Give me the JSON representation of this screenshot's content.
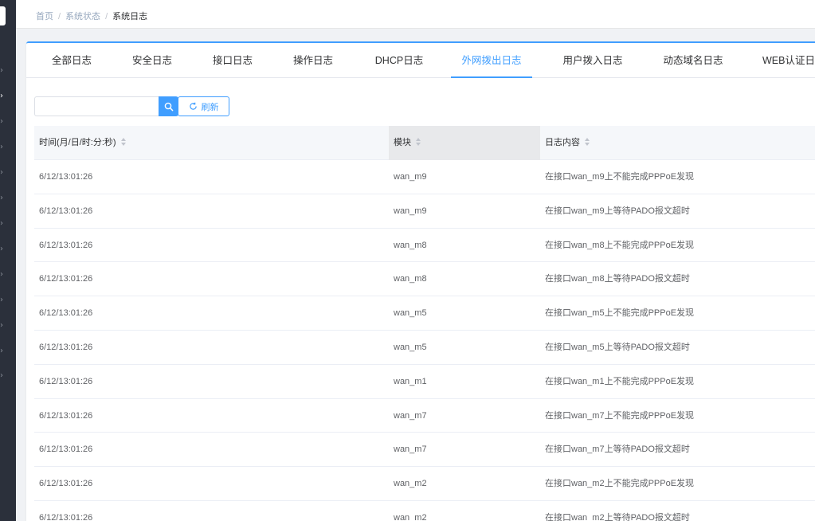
{
  "breadcrumb": {
    "items": [
      "首页",
      "系统状态"
    ],
    "separator": "/",
    "current": "系统日志"
  },
  "tabs": [
    {
      "label": "全部日志",
      "active": false
    },
    {
      "label": "安全日志",
      "active": false
    },
    {
      "label": "接口日志",
      "active": false
    },
    {
      "label": "操作日志",
      "active": false
    },
    {
      "label": "DHCP日志",
      "active": false
    },
    {
      "label": "外网拨出日志",
      "active": true
    },
    {
      "label": "用户拨入日志",
      "active": false
    },
    {
      "label": "动态域名日志",
      "active": false
    },
    {
      "label": "WEB认证日",
      "active": false
    }
  ],
  "toolbar": {
    "search_value": "",
    "search_placeholder": "",
    "refresh_label": "刷新"
  },
  "table": {
    "columns": [
      "时间(月/日/时:分:秒)",
      "模块",
      "日志内容"
    ],
    "sorted_column": 1,
    "rows": [
      [
        "6/12/13:01:26",
        "wan_m9",
        "在接口wan_m9上不能完成PPPoE发现"
      ],
      [
        "6/12/13:01:26",
        "wan_m9",
        "在接口wan_m9上等待PADO报文超时"
      ],
      [
        "6/12/13:01:26",
        "wan_m8",
        "在接口wan_m8上不能完成PPPoE发现"
      ],
      [
        "6/12/13:01:26",
        "wan_m8",
        "在接口wan_m8上等待PADO报文超时"
      ],
      [
        "6/12/13:01:26",
        "wan_m5",
        "在接口wan_m5上不能完成PPPoE发现"
      ],
      [
        "6/12/13:01:26",
        "wan_m5",
        "在接口wan_m5上等待PADO报文超时"
      ],
      [
        "6/12/13:01:26",
        "wan_m1",
        "在接口wan_m1上不能完成PPPoE发现"
      ],
      [
        "6/12/13:01:26",
        "wan_m7",
        "在接口wan_m7上不能完成PPPoE发现"
      ],
      [
        "6/12/13:01:26",
        "wan_m7",
        "在接口wan_m7上等待PADO报文超时"
      ],
      [
        "6/12/13:01:26",
        "wan_m2",
        "在接口wan_m2上不能完成PPPoE发现"
      ],
      [
        "6/12/13:01:26",
        "wan_m2",
        "在接口wan_m2上等待PADO报文超时"
      ]
    ]
  },
  "colors": {
    "accent": "#409eff",
    "sidebar_bg": "#2b303b",
    "header_bg": "#f5f7fa"
  },
  "icons": {
    "search": "search-icon",
    "refresh": "refresh-icon",
    "sidebar_chevron": "chevron-right-icon",
    "sort": "sort-caret-icon"
  }
}
